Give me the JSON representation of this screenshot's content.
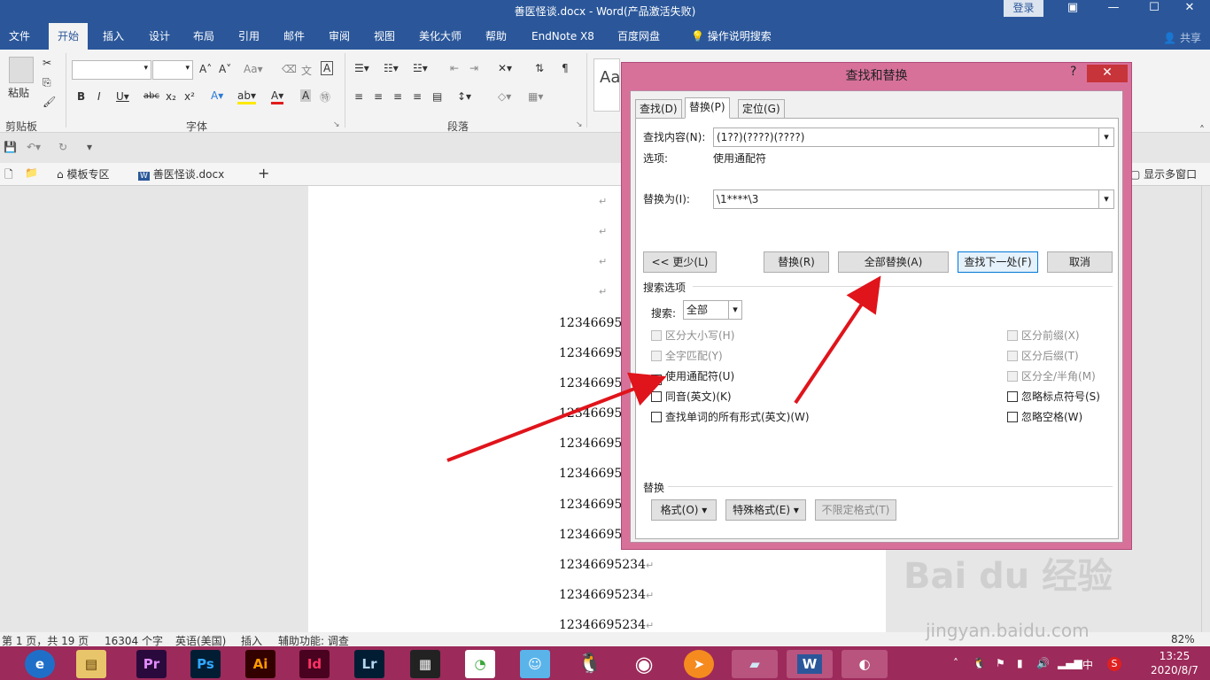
{
  "titlebar": {
    "title": "善医怪谈.docx - Word(产品激活失败)",
    "login": "登录",
    "restore_icon": "ribbon-display-icon",
    "min": "—",
    "max": "☐",
    "close": "✕"
  },
  "tabs": [
    "文件",
    "开始",
    "插入",
    "设计",
    "布局",
    "引用",
    "邮件",
    "审阅",
    "视图",
    "美化大师",
    "帮助",
    "EndNote X8",
    "百度网盘",
    "操作说明搜索"
  ],
  "share": "共享",
  "ribbon": {
    "paste": "粘贴",
    "group_clipboard": "剪贴板",
    "group_font": "字体",
    "group_paragraph": "段落"
  },
  "doctabs": {
    "template": "模板专区",
    "doc": "善医怪谈.docx",
    "add": "+",
    "multiwin": "显示多窗口"
  },
  "doc_lines": [
    "12346695234",
    "12346695234",
    "12346695234",
    "12346695234",
    "12346695234",
    "12346695234",
    "12346695234",
    "12346695234",
    "12346695234",
    "12346695234",
    "12346695234"
  ],
  "status": {
    "page": "第 1 页，共 19 页",
    "words": "16304 个字",
    "lang": "英语(美国)",
    "mode": "插入",
    "access": "辅助功能: 调查",
    "zoom": "82%"
  },
  "dialog": {
    "title": "查找和替换",
    "help": "?",
    "close": "✕",
    "tabs": [
      "查找(D)",
      "替换(P)",
      "定位(G)"
    ],
    "find_label": "查找内容(N):",
    "find_value": "(1??)(????)(????)",
    "options_label": "选项:",
    "options_value": "使用通配符",
    "replace_label": "替换为(I):",
    "replace_value": "\\1****\\3",
    "btn_less": "<< 更少(L)",
    "btn_replace": "替换(R)",
    "btn_replace_all": "全部替换(A)",
    "btn_find_next": "查找下一处(F)",
    "btn_cancel": "取消",
    "search_options": "搜索选项",
    "search_label": "搜索:",
    "search_value": "全部",
    "left_checks": [
      {
        "label": "区分大小写(H)",
        "checked": false,
        "disabled": true
      },
      {
        "label": "全字匹配(Y)",
        "checked": false,
        "disabled": true
      },
      {
        "label": "使用通配符(U)",
        "checked": true,
        "disabled": false
      },
      {
        "label": "同音(英文)(K)",
        "checked": false,
        "disabled": false
      },
      {
        "label": "查找单词的所有形式(英文)(W)",
        "checked": false,
        "disabled": false
      }
    ],
    "right_checks": [
      {
        "label": "区分前缀(X)",
        "checked": false,
        "disabled": true
      },
      {
        "label": "区分后缀(T)",
        "checked": false,
        "disabled": true
      },
      {
        "label": "区分全/半角(M)",
        "checked": false,
        "disabled": true
      },
      {
        "label": "忽略标点符号(S)",
        "checked": false,
        "disabled": false
      },
      {
        "label": "忽略空格(W)",
        "checked": false,
        "disabled": false
      }
    ],
    "replace_section": "替换",
    "btn_format": "格式(O) ▾",
    "btn_special": "特殊格式(E) ▾",
    "btn_noformat": "不限定格式(T)"
  },
  "taskbar": {
    "apps": [
      "Pr",
      "Ps",
      "Ai",
      "Id",
      "Lr"
    ],
    "time": "13:25",
    "date": "2020/8/7",
    "ime": "中"
  },
  "colors": {
    "word_blue": "#2b579a",
    "dialog_frame": "#d7719a",
    "taskbar": "#9c2a5a",
    "arrow": "#e0141b"
  }
}
